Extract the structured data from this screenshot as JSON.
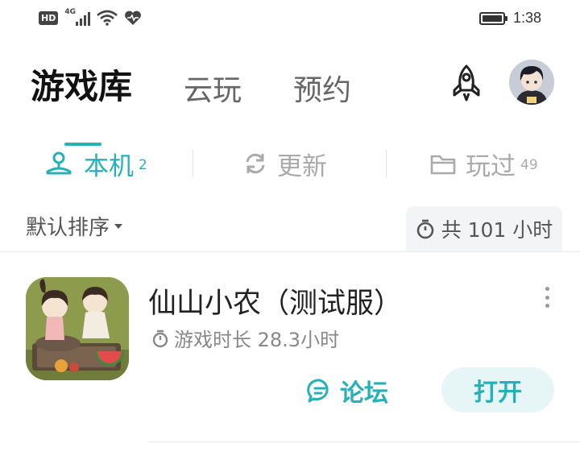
{
  "status_bar": {
    "network_badge": "HD",
    "network_type": "4G",
    "time": "1:38"
  },
  "header": {
    "tabs": [
      {
        "label": "游戏库",
        "active": true
      },
      {
        "label": "云玩",
        "active": false
      },
      {
        "label": "预约",
        "active": false
      }
    ]
  },
  "subtabs": [
    {
      "label": "本机",
      "count": "2",
      "active": true,
      "icon": "local-device-icon"
    },
    {
      "label": "更新",
      "count": "",
      "active": false,
      "icon": "refresh-icon"
    },
    {
      "label": "玩过",
      "count": "49",
      "active": false,
      "icon": "folder-icon"
    }
  ],
  "sort": {
    "label": "默认排序"
  },
  "total_hours": {
    "label": "共 101 小时"
  },
  "game": {
    "title": "仙山小农（测试服）",
    "playtime": "游戏时长 28.3小时",
    "forum_label": "论坛",
    "open_label": "打开"
  },
  "colors": {
    "accent": "#26b0b8",
    "open_button_bg": "#e6f6f7",
    "hours_bg": "#f2f4f5"
  }
}
